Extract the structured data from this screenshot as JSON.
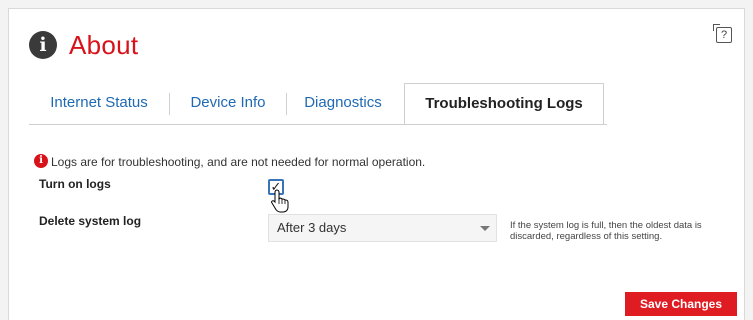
{
  "header": {
    "title": "About",
    "info_icon": "info-icon",
    "help_icon_label": "?"
  },
  "tabs": [
    {
      "label": "Internet Status",
      "active": false
    },
    {
      "label": "Device Info",
      "active": false
    },
    {
      "label": "Diagnostics",
      "active": false
    },
    {
      "label": "Troubleshooting Logs",
      "active": true
    }
  ],
  "notice": {
    "icon": "info-icon",
    "text": "Logs are for troubleshooting, and are not needed for normal operation."
  },
  "turn_on_logs": {
    "label": "Turn on logs",
    "checked": true,
    "check_mark": "✓"
  },
  "delete_log": {
    "label": "Delete system log",
    "selected": "After 3 days",
    "help": "If the system log is full, then the oldest data is discarded, regardless of this setting."
  },
  "actions": {
    "save_label": "Save Changes"
  },
  "colors": {
    "accent": "#d8121a",
    "link": "#1f69b3",
    "button": "#e01c23"
  }
}
